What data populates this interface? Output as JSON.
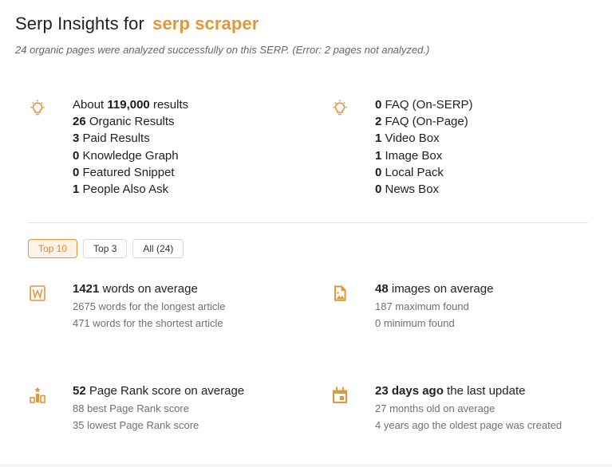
{
  "header": {
    "title_prefix": "Serp Insights for",
    "keyword": "serp scraper",
    "subtitle": "24 organic pages were analyzed successfully on this SERP. (Error: 2 pages not analyzed.)"
  },
  "colors": {
    "accent": "#e0963a",
    "active_tab_bg": "#fdf3e7"
  },
  "serp_features_left": {
    "icon": "lightbulb-icon",
    "items": [
      {
        "pre": "About ",
        "value": "119,000",
        "label": " results"
      },
      {
        "pre": "",
        "value": "26",
        "label": " Organic Results"
      },
      {
        "pre": "",
        "value": "3",
        "label": " Paid Results"
      },
      {
        "pre": "",
        "value": "0",
        "label": " Knowledge Graph"
      },
      {
        "pre": "",
        "value": "0",
        "label": " Featured Snippet"
      },
      {
        "pre": "",
        "value": "1",
        "label": " People Also Ask"
      }
    ]
  },
  "serp_features_right": {
    "icon": "lightbulb-icon",
    "items": [
      {
        "pre": "",
        "value": "0",
        "label": " FAQ (On-SERP)"
      },
      {
        "pre": "",
        "value": "2",
        "label": " FAQ (On-Page)"
      },
      {
        "pre": "",
        "value": "1",
        "label": " Video Box"
      },
      {
        "pre": "",
        "value": "1",
        "label": " Image Box"
      },
      {
        "pre": "",
        "value": "0",
        "label": " Local Pack"
      },
      {
        "pre": "",
        "value": "0",
        "label": " News Box"
      }
    ]
  },
  "tabs": [
    {
      "label": "Top 10",
      "active": true
    },
    {
      "label": "Top 3",
      "active": false
    },
    {
      "label": "All (24)",
      "active": false
    }
  ],
  "stats": {
    "words": {
      "icon": "word-count-icon",
      "value": "1421",
      "label": " words on average",
      "sub1": "2675 words for the longest article",
      "sub2": "471 words for the shortest article"
    },
    "images": {
      "icon": "image-file-icon",
      "value": "48",
      "label": " images on average",
      "sub1": "187 maximum found",
      "sub2": "0 minimum found"
    },
    "pagerank": {
      "icon": "podium-icon",
      "value": "52",
      "label": " Page Rank score on average",
      "sub1": "88 best Page Rank score",
      "sub2": "35 lowest Page Rank score"
    },
    "updated": {
      "icon": "calendar-icon",
      "value": "23 days ago",
      "label": " the last update",
      "sub1": "27 months old on average",
      "sub2": "4 years ago the oldest page was created"
    }
  }
}
